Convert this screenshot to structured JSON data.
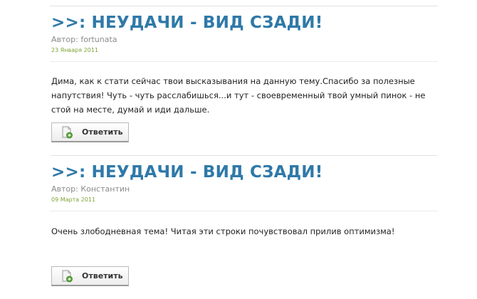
{
  "posts": [
    {
      "title": ">>: НЕУДАЧИ - ВИД СЗАДИ!",
      "author": "Автор: fortunata",
      "date": "23 Января 2011",
      "body": "Дима, как к стати  сейчас твои высказывания на данную тему.Спасибо за полезные напутствия! Чуть - чуть расслабишься...и тут - своевременный твой умный пинок - не стой на месте, думай и иди дальше.",
      "reply_label": "Ответить"
    },
    {
      "title": ">>: НЕУДАЧИ - ВИД СЗАДИ!",
      "author": "Автор: Константин",
      "date": "09 Марта 2011",
      "body": "Очень злободневная тема! Читая эти строки почувствовал прилив оптимизма!",
      "reply_label": "Ответить"
    }
  ],
  "colors": {
    "title": "#2f79a8",
    "date": "#7ca436",
    "author": "#8a8a8a",
    "icon_green": "#5aa83a"
  },
  "icons": {
    "reply": "document-add-icon"
  }
}
